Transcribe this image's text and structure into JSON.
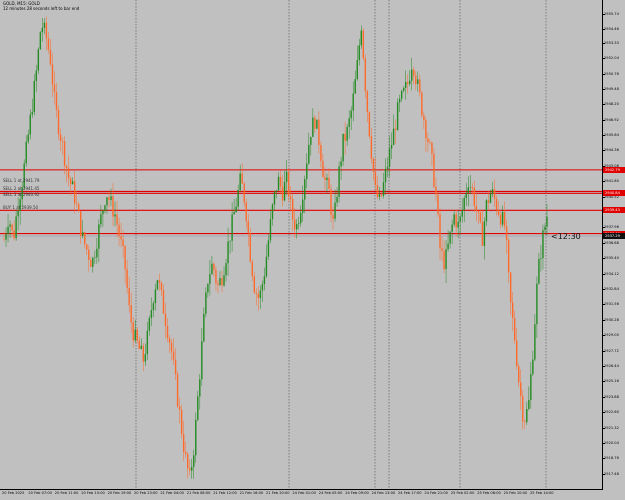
{
  "header": {
    "symbol": "GOLD, M15: GOLD",
    "timer_text": "12 minutes 28 seconds left to bar end"
  },
  "level_labels": [
    {
      "text": "SELL 1 at 2941.79",
      "price": 2941.79
    },
    {
      "text": "SELL 2 at 2941.45",
      "price": 2941.1
    },
    {
      "text": "SELL 3 at 2940.92",
      "price": 2940.6
    },
    {
      "text": "BUY 1 at 2939.50",
      "price": 2939.5
    }
  ],
  "countdown": "<12:30",
  "price_ticks": [
    "2955.74",
    "2954.46",
    "2953.33",
    "2952.04",
    "2950.76",
    "2949.48",
    "2948.20",
    "2946.92",
    "2945.64",
    "2944.36",
    "2943.08",
    "2941.80",
    "2940.52",
    "2939.24",
    "2937.96",
    "2936.68",
    "2935.40",
    "2934.12",
    "2932.84",
    "2931.56",
    "2930.28",
    "2929.00",
    "2927.72",
    "2926.44",
    "2925.16",
    "2923.88",
    "2922.60",
    "2921.32",
    "2920.04",
    "2918.76",
    "2917.48"
  ],
  "price_badges": [
    {
      "text": "2942.79",
      "price": 2942.79,
      "color": "#e00000"
    },
    {
      "text": "2940.84",
      "price": 2940.84,
      "color": "#e00000"
    },
    {
      "text": "2939.43",
      "price": 2939.43,
      "color": "#e00000"
    },
    {
      "text": "2937.49",
      "price": 2937.49,
      "color": "#e00000"
    },
    {
      "text": "2937.29",
      "price": 2937.29,
      "color": "#111111"
    }
  ],
  "time_ticks": [
    "20 Feb 2025",
    "20 Feb 07:00",
    "20 Feb 11:00",
    "20 Feb 15:00",
    "20 Feb 19:00",
    "20 Feb 23:00",
    "21 Feb 04:00",
    "21 Feb 08:00",
    "21 Feb 12:00",
    "21 Feb 16:00",
    "21 Feb 20:00",
    "24 Feb 01:00",
    "24 Feb 05:00",
    "24 Feb 09:00",
    "24 Feb 13:00",
    "24 Feb 17:00",
    "24 Feb 21:00",
    "25 Feb 02:00",
    "25 Feb 06:00",
    "25 Feb 10:00",
    "25 Feb 14:00"
  ],
  "chart_data": {
    "type": "candlestick",
    "symbol": "GOLD",
    "timeframe": "M15",
    "ylim": [
      2916.5,
      2956.5
    ],
    "colors": {
      "bull": "#228b22",
      "bear": "#ff6a2a",
      "level": "#e00000",
      "bid": "#9090b0",
      "background": "#c0c0c0",
      "separator": "#505050"
    },
    "horizontal_levels": [
      2942.79,
      2941.0,
      2940.84,
      2939.43,
      2937.49
    ],
    "bid_price": 2937.29,
    "day_separators": [
      2,
      5,
      9,
      13,
      16,
      19
    ],
    "path": [
      2937,
      2939,
      2937,
      2940,
      2942,
      2945,
      2948,
      2951,
      2955,
      2954,
      2952,
      2948,
      2946,
      2944,
      2942,
      2941,
      2939,
      2937,
      2936,
      2935,
      2937,
      2939,
      2941,
      2940,
      2939,
      2937,
      2935,
      2931,
      2929,
      2928,
      2927,
      2929,
      2932,
      2934,
      2932,
      2930,
      2928,
      2925,
      2922,
      2919,
      2917,
      2920,
      2925,
      2930,
      2934,
      2935,
      2933,
      2934,
      2936,
      2938,
      2940,
      2942,
      2940,
      2936,
      2933,
      2932,
      2934,
      2937,
      2940,
      2942,
      2941,
      2942,
      2939,
      2938,
      2940,
      2943,
      2946,
      2947,
      2945,
      2942,
      2941,
      2938,
      2942,
      2945,
      2946,
      2948,
      2951,
      2955,
      2949,
      2945,
      2941,
      2940,
      2942,
      2944,
      2946,
      2948,
      2949,
      2950,
      2952,
      2950,
      2948,
      2946,
      2944,
      2941,
      2936,
      2935,
      2937,
      2939,
      2938,
      2940,
      2942,
      2941,
      2939,
      2937,
      2940,
      2941,
      2940,
      2939,
      2938,
      2932,
      2929,
      2925,
      2922,
      2923,
      2928,
      2934,
      2937,
      2939
    ]
  }
}
